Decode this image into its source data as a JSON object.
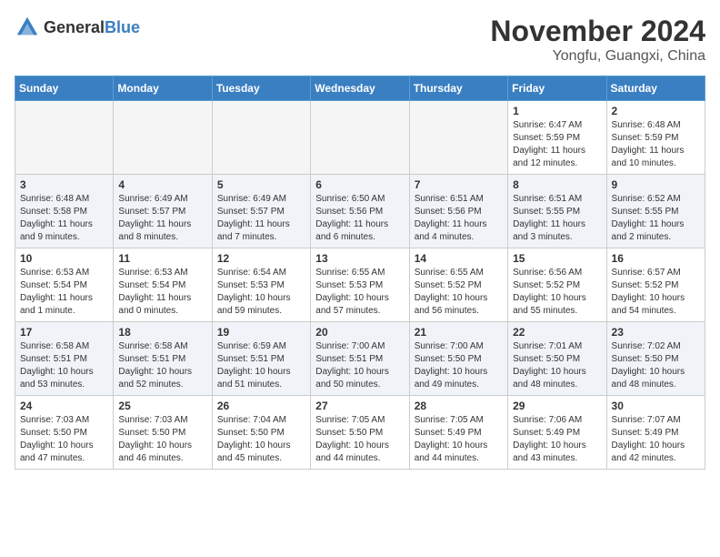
{
  "logo": {
    "text_general": "General",
    "text_blue": "Blue"
  },
  "header": {
    "month": "November 2024",
    "location": "Yongfu, Guangxi, China"
  },
  "weekdays": [
    "Sunday",
    "Monday",
    "Tuesday",
    "Wednesday",
    "Thursday",
    "Friday",
    "Saturday"
  ],
  "weeks": [
    [
      {
        "day": "",
        "info": ""
      },
      {
        "day": "",
        "info": ""
      },
      {
        "day": "",
        "info": ""
      },
      {
        "day": "",
        "info": ""
      },
      {
        "day": "",
        "info": ""
      },
      {
        "day": "1",
        "info": "Sunrise: 6:47 AM\nSunset: 5:59 PM\nDaylight: 11 hours and 12 minutes."
      },
      {
        "day": "2",
        "info": "Sunrise: 6:48 AM\nSunset: 5:59 PM\nDaylight: 11 hours and 10 minutes."
      }
    ],
    [
      {
        "day": "3",
        "info": "Sunrise: 6:48 AM\nSunset: 5:58 PM\nDaylight: 11 hours and 9 minutes."
      },
      {
        "day": "4",
        "info": "Sunrise: 6:49 AM\nSunset: 5:57 PM\nDaylight: 11 hours and 8 minutes."
      },
      {
        "day": "5",
        "info": "Sunrise: 6:49 AM\nSunset: 5:57 PM\nDaylight: 11 hours and 7 minutes."
      },
      {
        "day": "6",
        "info": "Sunrise: 6:50 AM\nSunset: 5:56 PM\nDaylight: 11 hours and 6 minutes."
      },
      {
        "day": "7",
        "info": "Sunrise: 6:51 AM\nSunset: 5:56 PM\nDaylight: 11 hours and 4 minutes."
      },
      {
        "day": "8",
        "info": "Sunrise: 6:51 AM\nSunset: 5:55 PM\nDaylight: 11 hours and 3 minutes."
      },
      {
        "day": "9",
        "info": "Sunrise: 6:52 AM\nSunset: 5:55 PM\nDaylight: 11 hours and 2 minutes."
      }
    ],
    [
      {
        "day": "10",
        "info": "Sunrise: 6:53 AM\nSunset: 5:54 PM\nDaylight: 11 hours and 1 minute."
      },
      {
        "day": "11",
        "info": "Sunrise: 6:53 AM\nSunset: 5:54 PM\nDaylight: 11 hours and 0 minutes."
      },
      {
        "day": "12",
        "info": "Sunrise: 6:54 AM\nSunset: 5:53 PM\nDaylight: 10 hours and 59 minutes."
      },
      {
        "day": "13",
        "info": "Sunrise: 6:55 AM\nSunset: 5:53 PM\nDaylight: 10 hours and 57 minutes."
      },
      {
        "day": "14",
        "info": "Sunrise: 6:55 AM\nSunset: 5:52 PM\nDaylight: 10 hours and 56 minutes."
      },
      {
        "day": "15",
        "info": "Sunrise: 6:56 AM\nSunset: 5:52 PM\nDaylight: 10 hours and 55 minutes."
      },
      {
        "day": "16",
        "info": "Sunrise: 6:57 AM\nSunset: 5:52 PM\nDaylight: 10 hours and 54 minutes."
      }
    ],
    [
      {
        "day": "17",
        "info": "Sunrise: 6:58 AM\nSunset: 5:51 PM\nDaylight: 10 hours and 53 minutes."
      },
      {
        "day": "18",
        "info": "Sunrise: 6:58 AM\nSunset: 5:51 PM\nDaylight: 10 hours and 52 minutes."
      },
      {
        "day": "19",
        "info": "Sunrise: 6:59 AM\nSunset: 5:51 PM\nDaylight: 10 hours and 51 minutes."
      },
      {
        "day": "20",
        "info": "Sunrise: 7:00 AM\nSunset: 5:51 PM\nDaylight: 10 hours and 50 minutes."
      },
      {
        "day": "21",
        "info": "Sunrise: 7:00 AM\nSunset: 5:50 PM\nDaylight: 10 hours and 49 minutes."
      },
      {
        "day": "22",
        "info": "Sunrise: 7:01 AM\nSunset: 5:50 PM\nDaylight: 10 hours and 48 minutes."
      },
      {
        "day": "23",
        "info": "Sunrise: 7:02 AM\nSunset: 5:50 PM\nDaylight: 10 hours and 48 minutes."
      }
    ],
    [
      {
        "day": "24",
        "info": "Sunrise: 7:03 AM\nSunset: 5:50 PM\nDaylight: 10 hours and 47 minutes."
      },
      {
        "day": "25",
        "info": "Sunrise: 7:03 AM\nSunset: 5:50 PM\nDaylight: 10 hours and 46 minutes."
      },
      {
        "day": "26",
        "info": "Sunrise: 7:04 AM\nSunset: 5:50 PM\nDaylight: 10 hours and 45 minutes."
      },
      {
        "day": "27",
        "info": "Sunrise: 7:05 AM\nSunset: 5:50 PM\nDaylight: 10 hours and 44 minutes."
      },
      {
        "day": "28",
        "info": "Sunrise: 7:05 AM\nSunset: 5:49 PM\nDaylight: 10 hours and 44 minutes."
      },
      {
        "day": "29",
        "info": "Sunrise: 7:06 AM\nSunset: 5:49 PM\nDaylight: 10 hours and 43 minutes."
      },
      {
        "day": "30",
        "info": "Sunrise: 7:07 AM\nSunset: 5:49 PM\nDaylight: 10 hours and 42 minutes."
      }
    ]
  ]
}
